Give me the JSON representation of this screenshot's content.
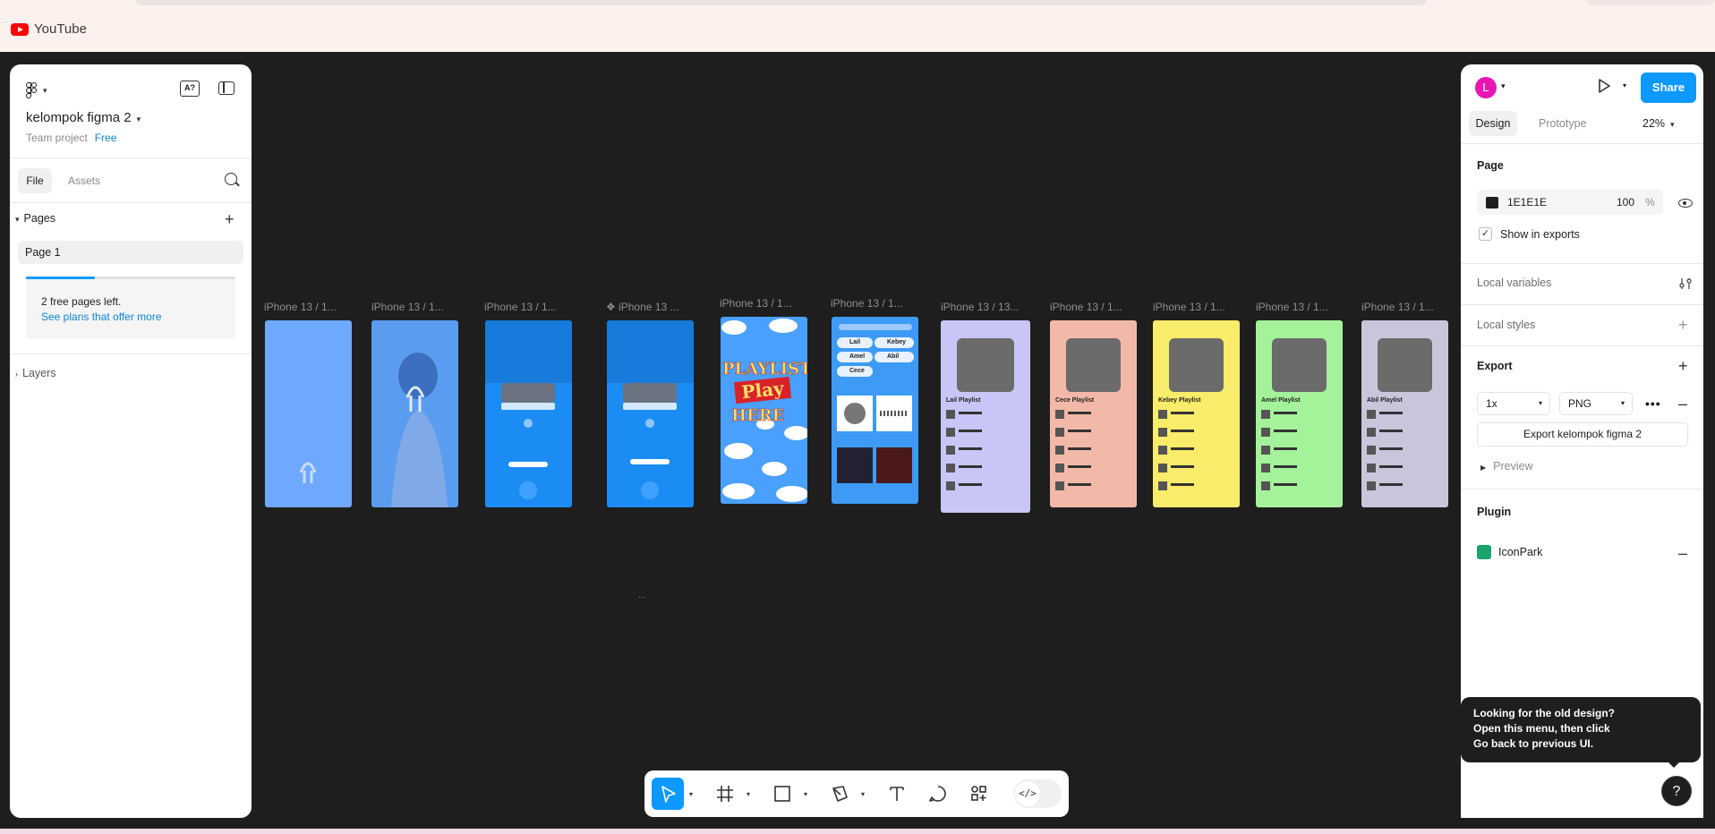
{
  "browser": {
    "tab_title": "YouTube"
  },
  "left_panel": {
    "project_name": "kelompok figma 2",
    "team": "Team project",
    "plan_badge": "Free",
    "tabs": [
      "File",
      "Assets"
    ],
    "pages_heading": "Pages",
    "current_page": "Page 1",
    "free_pages_text": "2 free pages left.",
    "plans_link": "See plans that offer more",
    "free_pages_progress": 0.33,
    "layers_heading": "Layers"
  },
  "canvas": {
    "frames": [
      {
        "label": "iPhone 13 / 1...",
        "color": "#6ea8ff"
      },
      {
        "label": "iPhone 13 / 1...",
        "color": "#5a9df0"
      },
      {
        "label": "iPhone 13 / 1...",
        "color": "#1c8cf5"
      },
      {
        "label": "❖ iPhone 13 ...",
        "color": "#1c8cf5"
      },
      {
        "label": "iPhone 13 / 1...",
        "color": "#4aa0ff",
        "texts": [
          "PLAYLIST",
          "Play",
          "HERE"
        ]
      },
      {
        "label": "iPhone 13 / 1...",
        "color": "#3d9bf5",
        "texts": [
          "Lail",
          "Kebey",
          "Amel",
          "Abil",
          "Cece"
        ]
      },
      {
        "label": "iPhone 13 / 13...",
        "color": "#c7c6f6",
        "texts": [
          "Lail Playlist"
        ]
      },
      {
        "label": "iPhone 13 / 1...",
        "color": "#f3b9a8",
        "texts": [
          "Cece Playlist"
        ]
      },
      {
        "label": "iPhone 13 / 1...",
        "color": "#f8ec6a",
        "texts": [
          "Kebey Playlist"
        ]
      },
      {
        "label": "iPhone 13 / 1...",
        "color": "#a4f29a",
        "texts": [
          "Amel Playlist"
        ]
      },
      {
        "label": "iPhone 13 / 1...",
        "color": "#c9c6dc",
        "texts": [
          "Abil Playlist"
        ]
      }
    ],
    "ellipsis": "..."
  },
  "toolbar": {
    "tools": [
      "move-tool",
      "frame-tool",
      "shape-tool",
      "pen-tool",
      "text-tool",
      "comment-tool",
      "actions-tool"
    ],
    "code_label": "</>"
  },
  "right_panel": {
    "avatar_initial": "L",
    "share_label": "Share",
    "tabs": [
      "Design",
      "Prototype"
    ],
    "zoom": "22%",
    "page_section": "Page",
    "bg_hex": "1E1E1E",
    "bg_color": "#1e1e1e",
    "bg_opacity": "100",
    "pct": "%",
    "show_in_exports": "Show in exports",
    "local_variables": "Local variables",
    "local_styles": "Local styles",
    "export_section": "Export",
    "export_scale": "1x",
    "export_format": "PNG",
    "export_button": "Export kelompok figma 2",
    "preview": "Preview",
    "plugin_section": "Plugin",
    "plugin_name": "IconPark"
  },
  "tooltip": {
    "title": "Looking for the old design?",
    "line1": "Open this menu, then click",
    "line2": "Go back to previous UI."
  },
  "help_label": "?"
}
